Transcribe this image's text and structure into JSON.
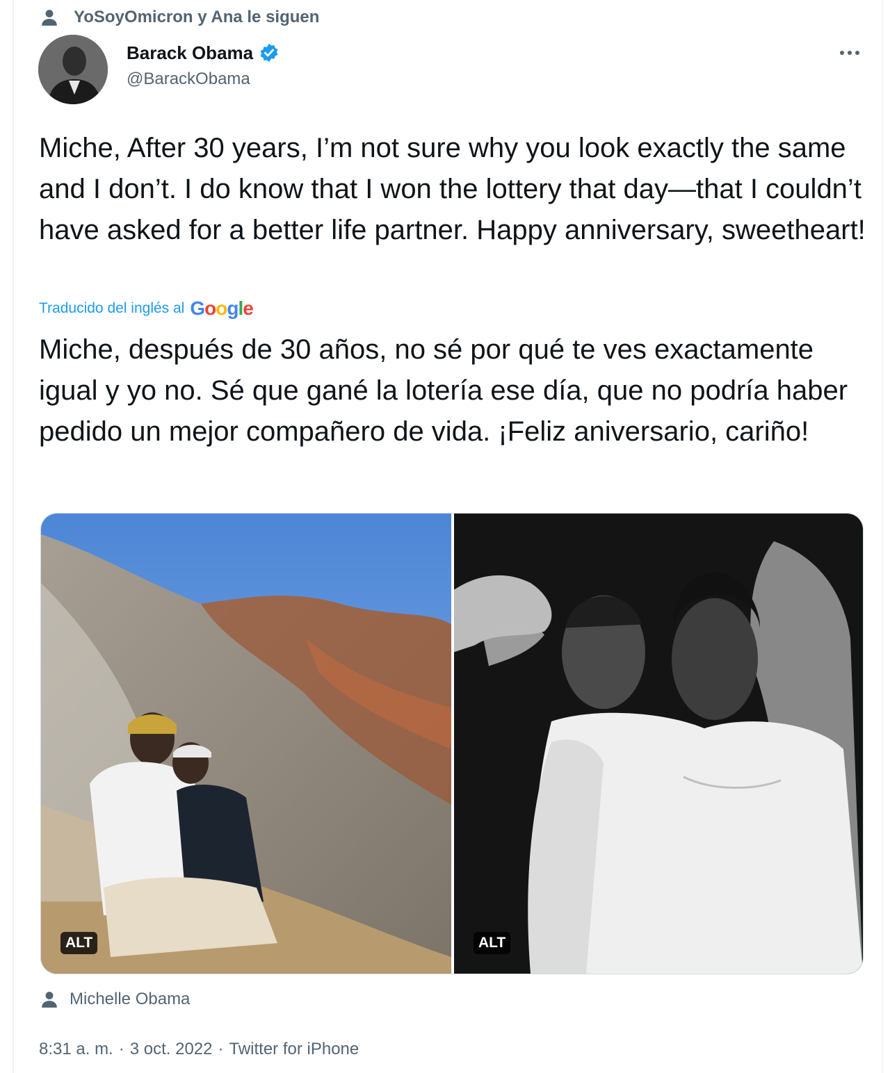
{
  "social_context": {
    "text": "YoSoyOmicron y Ana le siguen",
    "icon": "person-icon"
  },
  "author": {
    "display_name": "Barack Obama",
    "handle": "@BarackObama",
    "verified": true,
    "verified_icon": "verified-badge-icon"
  },
  "tweet": {
    "original_text": "Miche, After 30 years, I’m not sure why you look exactly the same and I don’t. I do know that I won the lottery that day—that I couldn’t have asked for a better life partner. Happy anniversary, sweetheart!",
    "translation_note": "Traducido del inglés al",
    "translation_provider": "Google",
    "translated_text": "Miche, después de 30 años, no sé por qué te ves exactamente igual y yo no. Sé que gané la lotería ese día, que no podría haber pedido un mejor compañero de vida. ¡Feliz aniversario, cariño!"
  },
  "media": [
    {
      "alt_label": "ALT"
    },
    {
      "alt_label": "ALT"
    }
  ],
  "tagged_user": "Michelle Obama",
  "meta": {
    "time": "8:31 a. m.",
    "separator": "·",
    "date": "3 oct. 2022",
    "source": "Twitter for iPhone"
  },
  "colors": {
    "text_primary": "#0f1419",
    "text_secondary": "#536471",
    "accent": "#1d9bf0",
    "border": "#cfd9de"
  }
}
